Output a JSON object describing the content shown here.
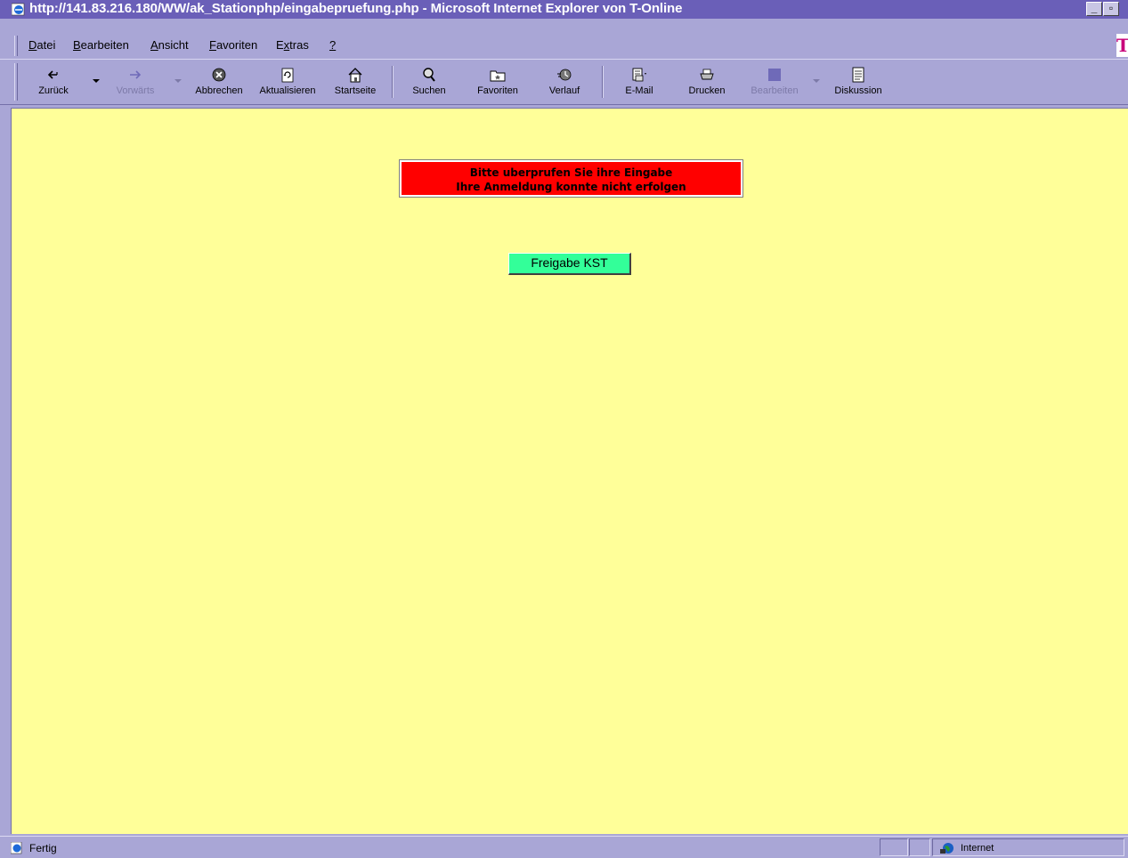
{
  "window": {
    "title": "http://141.83.216.180/WW/ak_Stationphp/eingabepruefung.php - Microsoft Internet Explorer von T-Online",
    "minimize_label": "_",
    "restore_label": "▫"
  },
  "menu": {
    "items": [
      {
        "accel": "D",
        "rest": "atei"
      },
      {
        "accel": "B",
        "rest": "earbeiten"
      },
      {
        "accel": "A",
        "rest": "nsicht"
      },
      {
        "accel": "F",
        "rest": "avoriten"
      },
      {
        "pre": "E",
        "accel": "x",
        "rest": "tras"
      },
      {
        "accel": "?",
        "rest": ""
      }
    ],
    "logo": "T"
  },
  "toolbar": {
    "back": "Zurück",
    "forward": "Vorwärts",
    "stop": "Abbrechen",
    "refresh": "Aktualisieren",
    "home": "Startseite",
    "search": "Suchen",
    "favorites": "Favoriten",
    "history": "Verlauf",
    "mail": "E-Mail",
    "print": "Drucken",
    "edit": "Bearbeiten",
    "discuss": "Diskussion"
  },
  "page": {
    "error_line1": "Bitte uberprufen Sie ihre Eingabe",
    "error_line2": "Ihre Anmeldung konnte nicht erfolgen",
    "button_label": "Freigabe KST",
    "error_bg": "#ff0000",
    "button_bg": "#33ff99",
    "page_bg": "#ffff99"
  },
  "status": {
    "text": "Fertig",
    "zone": "Internet"
  }
}
